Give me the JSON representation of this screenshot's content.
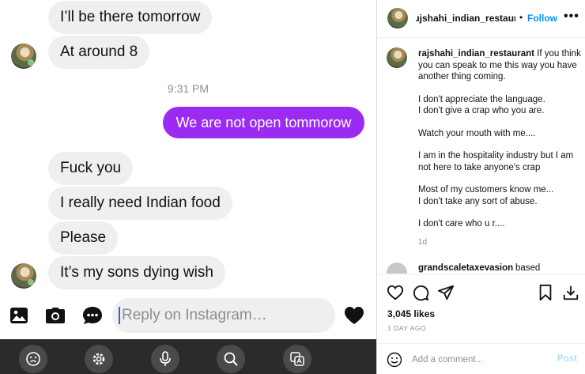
{
  "dm": {
    "messages_top": [
      {
        "text": "I’ll be there tomorrow"
      },
      {
        "text": "At around 8"
      }
    ],
    "timestamp": "9:31 PM",
    "sent_message": "We are not open tommorow",
    "messages_bottom": [
      {
        "text": "Fuck you"
      },
      {
        "text": "I really need Indian food"
      },
      {
        "text": "Please"
      },
      {
        "text": "It’s my sons dying wish"
      }
    ],
    "composer": {
      "placeholder": "Reply on Instagram…",
      "icons": [
        "image-icon",
        "camera-icon",
        "chat-bubble-icon",
        "heart-icon"
      ]
    },
    "taskbar_icons": [
      "emoji-icon",
      "settings-icon",
      "microphone-icon",
      "search-icon",
      "translate-icon"
    ],
    "colors": {
      "sent_bubble": "#9b2bf0",
      "received_bubble": "#efefef"
    }
  },
  "post": {
    "header": {
      "username": "ɹjshahi_indian_restaurant",
      "separator": "•",
      "follow_label": "Follow",
      "more_label": "•••"
    },
    "caption": {
      "username": "rajshahi_indian_restaurant",
      "first_line": "If you think you can speak to me this way you have another thing coming.",
      "paragraphs": [
        "I don't appreciate the language.\nI don't give a crap who you are.",
        "Watch your mouth with me....",
        "I am in the hospitality industry but I am not here to take anyone's crap",
        "Most of my customers know me...\nI don't take any sort of abuse.",
        "I don't care who u r...."
      ],
      "age": "1d"
    },
    "comment_peek": {
      "username": "grandscaletaxevasion",
      "text": "based"
    },
    "likes": "3,045 likes",
    "post_age": "1 DAY AGO",
    "comment_placeholder": "Add a comment...",
    "post_button": "Post",
    "colors": {
      "follow": "#0095f6",
      "post_disabled": "#b2dffc"
    }
  }
}
